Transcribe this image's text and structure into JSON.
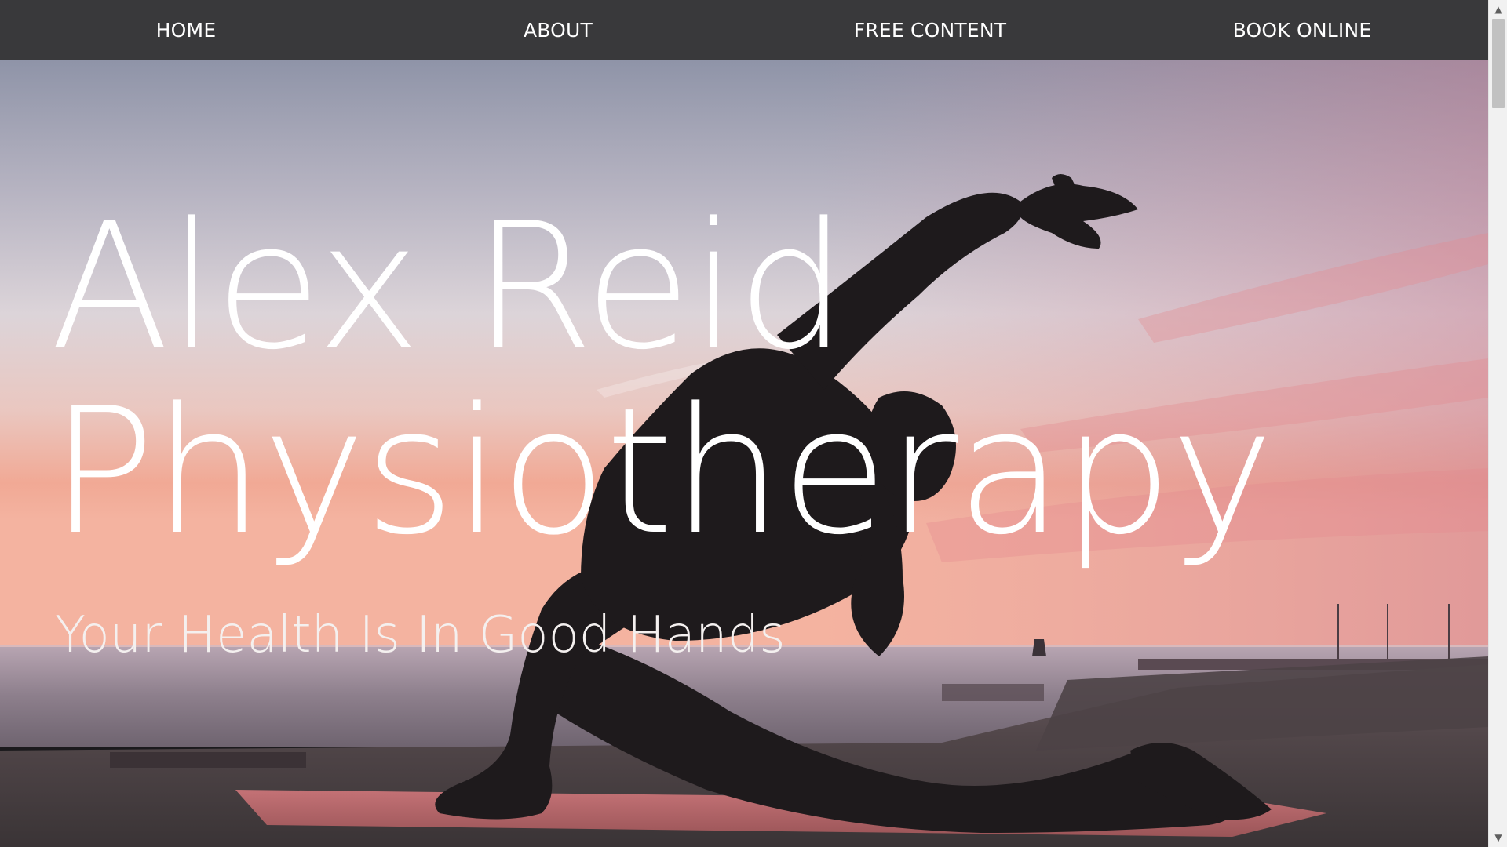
{
  "nav": {
    "items": [
      {
        "label": "HOME"
      },
      {
        "label": "ABOUT"
      },
      {
        "label": "FREE CONTENT"
      },
      {
        "label": "BOOK ONLINE"
      }
    ]
  },
  "hero": {
    "title_line_1": "Alex Reid",
    "title_line_2": "Physiotherapy",
    "tagline": "Your Health Is In Good Hands",
    "background": "sunset-yoga-silhouette-photo"
  },
  "colors": {
    "navbar": "#39393b",
    "nav_text": "#ffffff",
    "title_text": "#ffffff",
    "sky_top": "#9c9fb2",
    "sky_mid": "#d8d2d8",
    "sky_horizon": "#f0a68c",
    "silhouette": "#1f1b1d",
    "yoga_mat": "#c06a6e"
  },
  "scrollbar": {
    "up_icon": "▲",
    "down_icon": "▼"
  }
}
